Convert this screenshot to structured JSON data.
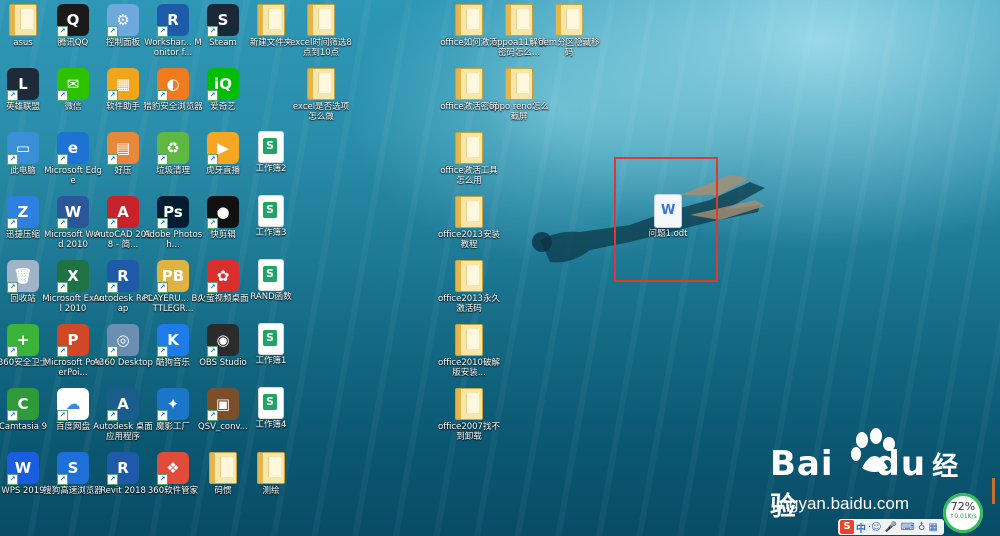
{
  "desktop": {
    "icons": [
      {
        "label": "asus",
        "kind": "user"
      },
      {
        "label": "腾讯QQ",
        "kind": "app",
        "color": "#1a1a1a",
        "glyph": "Q"
      },
      {
        "label": "控制面板",
        "kind": "app",
        "color": "#6fa8dc",
        "glyph": "⚙"
      },
      {
        "label": "Workshar... Monitor f...",
        "kind": "app",
        "color": "#1e5aa8",
        "glyph": "R"
      },
      {
        "label": "Steam",
        "kind": "app",
        "color": "#1b2838",
        "glyph": "S"
      },
      {
        "label": "新建文件夹",
        "kind": "folder"
      },
      {
        "label": "excel时间筛选8点到10点",
        "kind": "folder"
      },
      {
        "label": "英雄联盟",
        "kind": "app",
        "color": "#1d2a3a",
        "glyph": "L"
      },
      {
        "label": "微信",
        "kind": "app",
        "color": "#2dc100",
        "glyph": "✉"
      },
      {
        "label": "软件助手",
        "kind": "app",
        "color": "#f1a51b",
        "glyph": "▦"
      },
      {
        "label": "猎豹安全浏览器",
        "kind": "app",
        "color": "#f07b1e",
        "glyph": "◐"
      },
      {
        "label": "爱奇艺",
        "kind": "app",
        "color": "#00be06",
        "glyph": "iQ"
      },
      {
        "label": "excel是否选项怎么做",
        "kind": "folder"
      },
      {
        "label": "此电脑",
        "kind": "app",
        "color": "#3a8fd6",
        "glyph": "▭"
      },
      {
        "label": "Microsoft Edge",
        "kind": "app",
        "color": "#1e73d2",
        "glyph": "e"
      },
      {
        "label": "好压",
        "kind": "app",
        "color": "#e6873a",
        "glyph": "▤"
      },
      {
        "label": "垃圾清理",
        "kind": "app",
        "color": "#5fb844",
        "glyph": "♻"
      },
      {
        "label": "虎牙直播",
        "kind": "app",
        "color": "#f5a623",
        "glyph": "▶"
      },
      {
        "label": "工作簿2",
        "kind": "sheet"
      },
      {
        "label": "迅捷压缩",
        "kind": "app",
        "color": "#2f7fe0",
        "glyph": "Z"
      },
      {
        "label": "Microsoft Word 2010",
        "kind": "app",
        "color": "#2b579a",
        "glyph": "W"
      },
      {
        "label": "AutoCAD 2018 - 简...",
        "kind": "app",
        "color": "#c8222b",
        "glyph": "A"
      },
      {
        "label": "Adobe Photosh...",
        "kind": "app",
        "color": "#001d34",
        "glyph": "Ps"
      },
      {
        "label": "快剪辑",
        "kind": "app",
        "color": "#111111",
        "glyph": "●"
      },
      {
        "label": "工作簿3",
        "kind": "sheet"
      },
      {
        "label": "回收站",
        "kind": "app",
        "color": "#9fb4c8",
        "glyph": "🗑"
      },
      {
        "label": "Microsoft Excel 2010",
        "kind": "app",
        "color": "#1f7244",
        "glyph": "X"
      },
      {
        "label": "Autodesk ReCap",
        "kind": "app",
        "color": "#1e5aa8",
        "glyph": "R"
      },
      {
        "label": "PLAYERU... BATTLEGR...",
        "kind": "app",
        "color": "#e0b341",
        "glyph": "PB"
      },
      {
        "label": "火萤视频桌面",
        "kind": "app",
        "color": "#d9302e",
        "glyph": "✿"
      },
      {
        "label": "RAND函数",
        "kind": "sheet"
      },
      {
        "label": "360安全卫士",
        "kind": "app",
        "color": "#3bb33b",
        "glyph": "+"
      },
      {
        "label": "Microsoft PowerPoi...",
        "kind": "app",
        "color": "#d24726",
        "glyph": "P"
      },
      {
        "label": "A360 Desktop",
        "kind": "app",
        "color": "#6b8fb3",
        "glyph": "◎"
      },
      {
        "label": "酷狗音乐",
        "kind": "app",
        "color": "#1e7ce8",
        "glyph": "K"
      },
      {
        "label": "OBS Studio",
        "kind": "app",
        "color": "#2b2b2b",
        "glyph": "◉"
      },
      {
        "label": "工作簿1",
        "kind": "sheet"
      },
      {
        "label": "Camtasia 9",
        "kind": "app",
        "color": "#2e9a3a",
        "glyph": "C"
      },
      {
        "label": "百度网盘",
        "kind": "app",
        "color": "#ffffff",
        "glyph": "☁"
      },
      {
        "label": "Autodesk 桌面应用程序",
        "kind": "app",
        "color": "#1a5c8a",
        "glyph": "A"
      },
      {
        "label": "魔影工厂",
        "kind": "app",
        "color": "#1b76c8",
        "glyph": "✦"
      },
      {
        "label": "QSV_conv...",
        "kind": "app",
        "color": "#7a4f2a",
        "glyph": "▣"
      },
      {
        "label": "工作簿4",
        "kind": "sheet"
      },
      {
        "label": "WPS 2019",
        "kind": "app",
        "color": "#1a5ee0",
        "glyph": "W"
      },
      {
        "label": "搜狗高速浏览器",
        "kind": "app",
        "color": "#1e6fd8",
        "glyph": "S"
      },
      {
        "label": "Revit 2018",
        "kind": "app",
        "color": "#1e5aa8",
        "glyph": "R"
      },
      {
        "label": "360软件管家",
        "kind": "app",
        "color": "#e04b3a",
        "glyph": "❖"
      },
      {
        "label": "码惯",
        "kind": "folder"
      },
      {
        "label": "测绘",
        "kind": "folder"
      },
      {
        "label": "office如何激活",
        "kind": "folder"
      },
      {
        "label": "oppoa11解锁密码怎么...",
        "kind": "folder"
      },
      {
        "label": "oem分区隐藏移码",
        "kind": "folder"
      },
      {
        "label": "office激活密钥",
        "kind": "folder"
      },
      {
        "label": "oppo reno怎么截屏",
        "kind": "folder"
      },
      {
        "label": "office激活工具怎么用",
        "kind": "folder"
      },
      {
        "label": "office2013安装教程",
        "kind": "folder"
      },
      {
        "label": "office2013永久激活码",
        "kind": "folder"
      },
      {
        "label": "office2010破解版安装...",
        "kind": "folder"
      },
      {
        "label": "office2007找不到卸载",
        "kind": "folder"
      },
      {
        "label": "问题1.odt",
        "kind": "doc"
      }
    ]
  },
  "watermark": {
    "brand": "Bai",
    "brand2": "du",
    "brand_cn": "经验",
    "url": "jingyan.baidu.com"
  },
  "tray": {
    "percent": "72%",
    "speed": "↑0.01K/s",
    "ime_logo": "S",
    "ime_lang": "中",
    "ime_icons": "·☺ 🎤 ⌨ ♁ ▦"
  },
  "colors": {
    "selection": "#d93b2f",
    "gauge_ring": "#2fbf5a"
  }
}
